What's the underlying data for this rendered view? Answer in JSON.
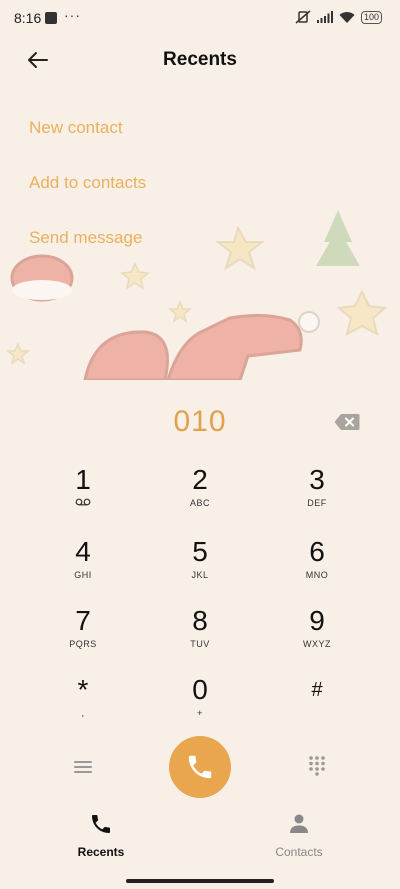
{
  "status_bar": {
    "time": "8:16",
    "overflow_dots": "···",
    "battery": "100"
  },
  "header": {
    "title": "Recents",
    "back_icon": "arrow-left-icon"
  },
  "menu": {
    "items": [
      {
        "label": "New contact"
      },
      {
        "label": "Add to contacts"
      },
      {
        "label": "Send message"
      }
    ]
  },
  "dialer": {
    "number": "010",
    "backspace_icon": "backspace-icon"
  },
  "keypad": {
    "keys": [
      {
        "digit": "1",
        "sub": "voicemail-icon"
      },
      {
        "digit": "2",
        "sub": "ABC"
      },
      {
        "digit": "3",
        "sub": "DEF"
      },
      {
        "digit": "4",
        "sub": "GHI"
      },
      {
        "digit": "5",
        "sub": "JKL"
      },
      {
        "digit": "6",
        "sub": "MNO"
      },
      {
        "digit": "7",
        "sub": "PQRS"
      },
      {
        "digit": "8",
        "sub": "TUV"
      },
      {
        "digit": "9",
        "sub": "WXYZ"
      },
      {
        "digit": "*",
        "sub": ","
      },
      {
        "digit": "0",
        "sub": "+"
      },
      {
        "digit": "#",
        "sub": ""
      }
    ]
  },
  "actions": {
    "menu_icon": "menu-icon",
    "call_icon": "phone-icon",
    "dialpad_icon": "dialpad-icon",
    "accent": "#e9a64e"
  },
  "bottom_nav": {
    "recents_label": "Recents",
    "contacts_label": "Contacts"
  }
}
